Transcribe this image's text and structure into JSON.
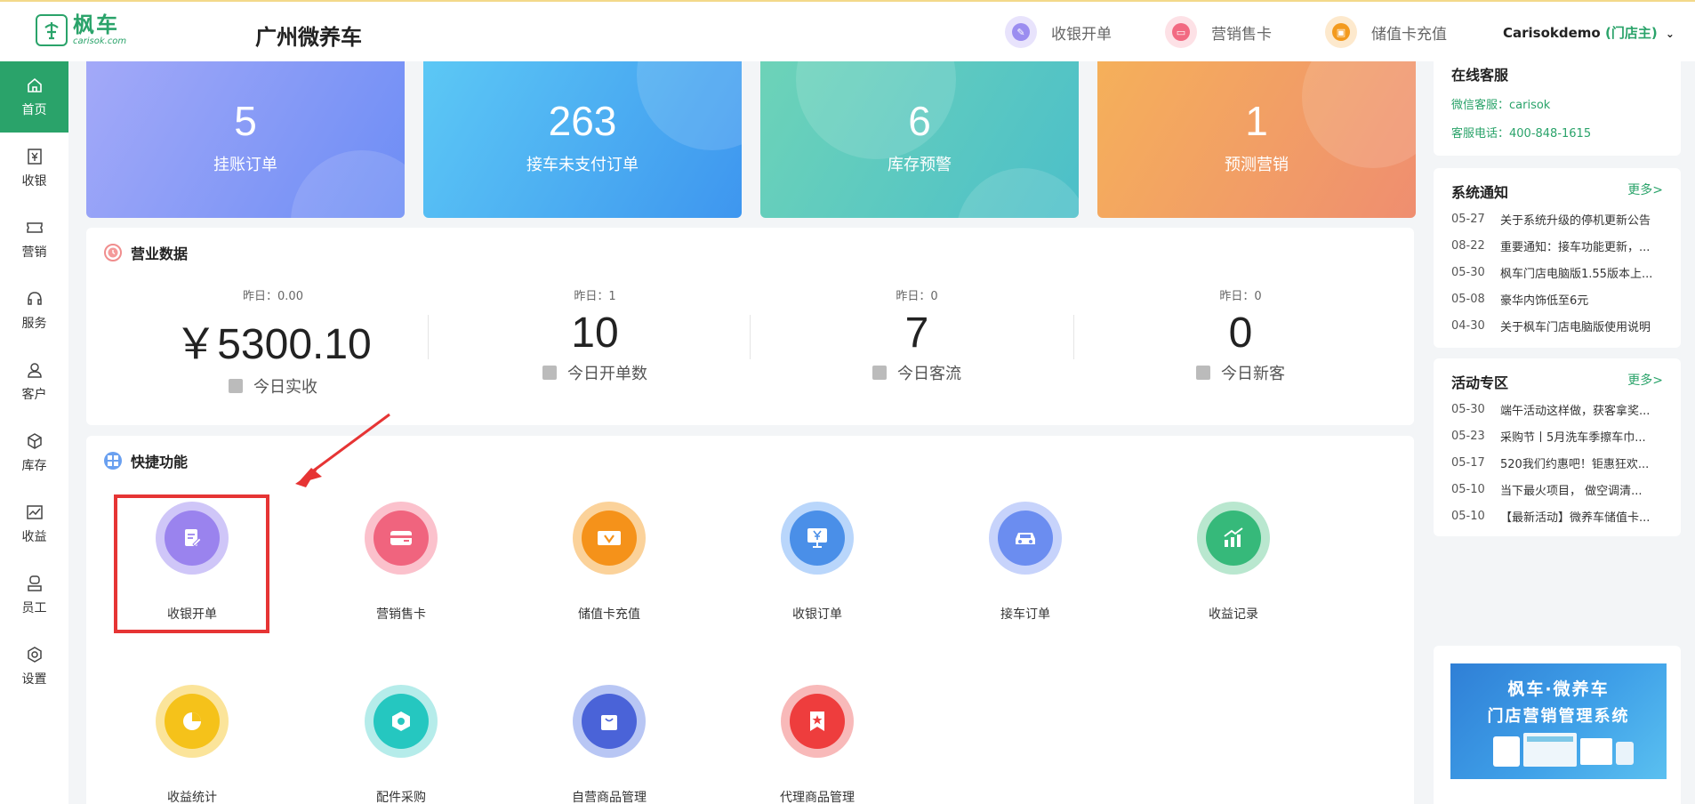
{
  "header": {
    "logo_cn": "枫车",
    "logo_en": "carisok.com",
    "store_name": "广州微养车",
    "actions": [
      {
        "label": "收银开单",
        "icon": "cashier-icon",
        "color": "#9b8df0"
      },
      {
        "label": "营销售卡",
        "icon": "card-icon",
        "color": "#f26a82"
      },
      {
        "label": "储值卡充值",
        "icon": "recharge-icon",
        "color": "#f39a1e"
      }
    ],
    "user_name": "Carisokdemo",
    "user_role": "(门店主)"
  },
  "sidebar": {
    "items": [
      {
        "label": "首页",
        "icon": "home-icon",
        "active": true
      },
      {
        "label": "收银",
        "icon": "yen-icon"
      },
      {
        "label": "营销",
        "icon": "ticket-icon"
      },
      {
        "label": "服务",
        "icon": "headset-icon"
      },
      {
        "label": "客户",
        "icon": "user-icon"
      },
      {
        "label": "库存",
        "icon": "box-icon"
      },
      {
        "label": "收益",
        "icon": "chart-icon"
      },
      {
        "label": "员工",
        "icon": "staff-icon"
      },
      {
        "label": "设置",
        "icon": "gear-icon"
      }
    ]
  },
  "stats": [
    {
      "value": "5",
      "label": "挂账订单"
    },
    {
      "value": "263",
      "label": "接车未支付订单"
    },
    {
      "value": "6",
      "label": "库存预警"
    },
    {
      "value": "1",
      "label": "预测营销"
    }
  ],
  "business": {
    "title": "营业数据",
    "items": [
      {
        "yesterday": "昨日：0.00",
        "value": "￥5300.10",
        "caption": "今日实收"
      },
      {
        "yesterday": "昨日：1",
        "value": "10",
        "caption": "今日开单数"
      },
      {
        "yesterday": "昨日：0",
        "value": "7",
        "caption": "今日客流"
      },
      {
        "yesterday": "昨日：0",
        "value": "0",
        "caption": "今日新客"
      }
    ]
  },
  "quick": {
    "title": "快捷功能",
    "items": [
      {
        "label": "收银开单",
        "icon": "edit-doc-icon",
        "ring": "#cfc6f8",
        "core": "#9a83ee"
      },
      {
        "label": "营销售卡",
        "icon": "card-icon",
        "ring": "#fbc1cc",
        "core": "#f0647e"
      },
      {
        "label": "储值卡充值",
        "icon": "vip-card-icon",
        "ring": "#fbd29a",
        "core": "#f5921a"
      },
      {
        "label": "收银订单",
        "icon": "monitor-yen-icon",
        "ring": "#b9d6fb",
        "core": "#4a8fe8"
      },
      {
        "label": "接车订单",
        "icon": "car-icon",
        "ring": "#c7d3fb",
        "core": "#6b8df0"
      },
      {
        "label": "收益记录",
        "icon": "growth-chart-icon",
        "ring": "#b9e7cf",
        "core": "#36b97a"
      },
      {
        "label": "收益统计",
        "icon": "pie-chart-icon",
        "ring": "#fbe49a",
        "core": "#f5c21a"
      },
      {
        "label": "配件采购",
        "icon": "hex-nut-icon",
        "ring": "#b5ecea",
        "core": "#25c7c0"
      },
      {
        "label": "自营商品管理",
        "icon": "shopping-bag-icon",
        "ring": "#b8c6f4",
        "core": "#4a63d8"
      },
      {
        "label": "代理商品管理",
        "icon": "star-bookmark-icon",
        "ring": "#f8b9b9",
        "core": "#ee3d3d"
      }
    ]
  },
  "support": {
    "title": "在线客服",
    "wechat": "微信客服：carisok",
    "phone": "客服电话：400-848-1615"
  },
  "notices": {
    "title": "系统通知",
    "more": "更多>",
    "items": [
      {
        "date": "05-27",
        "text": "关于系统升级的停机更新公告"
      },
      {
        "date": "08-22",
        "text": "重要通知：接车功能更新，..."
      },
      {
        "date": "05-30",
        "text": "枫车门店电脑版1.55版本上..."
      },
      {
        "date": "05-08",
        "text": "豪华内饰低至6元"
      },
      {
        "date": "04-30",
        "text": "关于枫车门店电脑版使用说明"
      }
    ]
  },
  "activities": {
    "title": "活动专区",
    "more": "更多>",
    "items": [
      {
        "date": "05-30",
        "text": "端午活动这样做，获客拿奖..."
      },
      {
        "date": "05-23",
        "text": "采购节丨5月洗车季擦车巾..."
      },
      {
        "date": "05-17",
        "text": "520我们约惠吧！钜惠狂欢..."
      },
      {
        "date": "05-10",
        "text": "当下最火项目， 做空调清..."
      },
      {
        "date": "05-10",
        "text": "【最新活动】微养车储值卡..."
      }
    ]
  },
  "banner": {
    "line1": "枫车·微养车",
    "line2": "门店营销管理系统"
  }
}
